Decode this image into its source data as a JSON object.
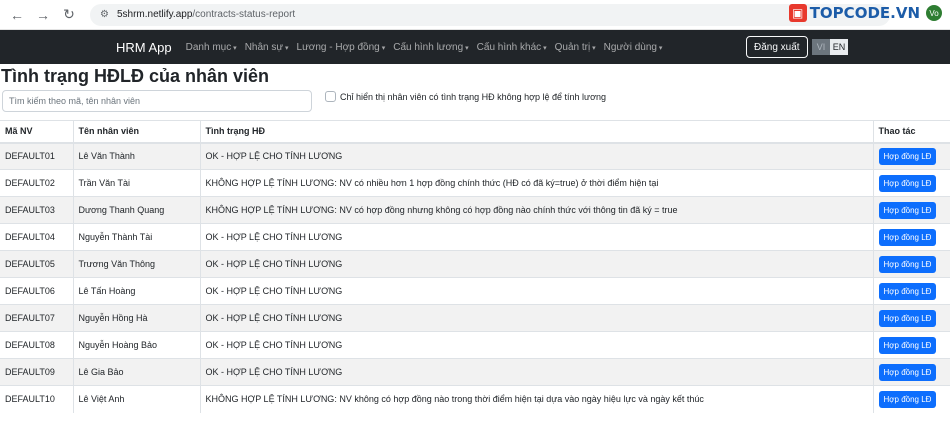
{
  "browser": {
    "url_host": "5shrm.netlify.app",
    "url_path": "/contracts-status-report",
    "avatar_text": "Vo",
    "watermark_logo": "TOPCODE.VN"
  },
  "navbar": {
    "brand": "HRM App",
    "items": [
      "Danh mục",
      "Nhân sự",
      "Lương - Hợp đồng",
      "Cấu hình lương",
      "Cấu hình khác",
      "Quản trị",
      "Người dùng"
    ],
    "logout_label": "Đăng xuất",
    "lang_vi": "VI",
    "lang_en": "EN"
  },
  "page": {
    "title": "Tình trạng HĐLĐ của nhân viên",
    "search_placeholder": "Tìm kiếm theo mã, tên nhân viên",
    "filter_label": "Chỉ hiển thị nhân viên có tình trạng HĐ không hợp lệ để tính lương"
  },
  "table": {
    "headers": [
      "Mã NV",
      "Tên nhân viên",
      "Tình trạng HĐ",
      "Thao tác"
    ],
    "action_label": "Hợp đồng LĐ",
    "rows": [
      {
        "id": "DEFAULT01",
        "name": "Lê Văn Thành",
        "status": "OK - HỢP LỆ CHO TÍNH LƯƠNG"
      },
      {
        "id": "DEFAULT02",
        "name": "Trần Văn Tài",
        "status": "KHÔNG HỢP LỆ TÍNH LƯƠNG: NV có nhiều hơn 1 hợp đồng chính thức (HĐ có đã ký=true) ở thời điểm hiện tại"
      },
      {
        "id": "DEFAULT03",
        "name": "Dương Thanh Quang",
        "status": "KHÔNG HỢP LỆ TÍNH LƯƠNG: NV có hợp đồng nhưng không có hợp đồng nào chính thức với thông tin đã ký = true"
      },
      {
        "id": "DEFAULT04",
        "name": "Nguyễn Thành Tài",
        "status": "OK - HỢP LỆ CHO TÍNH LƯƠNG"
      },
      {
        "id": "DEFAULT05",
        "name": "Trương Văn Thông",
        "status": "OK - HỢP LỆ CHO TÍNH LƯƠNG"
      },
      {
        "id": "DEFAULT06",
        "name": "Lê Tấn Hoàng",
        "status": "OK - HỢP LỆ CHO TÍNH LƯƠNG"
      },
      {
        "id": "DEFAULT07",
        "name": "Nguyễn Hồng Hà",
        "status": "OK - HỢP LỆ CHO TÍNH LƯƠNG"
      },
      {
        "id": "DEFAULT08",
        "name": "Nguyễn Hoàng Bảo",
        "status": "OK - HỢP LỆ CHO TÍNH LƯƠNG"
      },
      {
        "id": "DEFAULT09",
        "name": "Lê Gia Bảo",
        "status": "OK - HỢP LỆ CHO TÍNH LƯƠNG"
      },
      {
        "id": "DEFAULT10",
        "name": "Lê Việt Anh",
        "status": "KHÔNG HỢP LỆ TÍNH LƯƠNG: NV không có hợp đồng nào trong thời điểm hiện tại dựa vào ngày hiệu lực và ngày kết thúc"
      }
    ]
  }
}
